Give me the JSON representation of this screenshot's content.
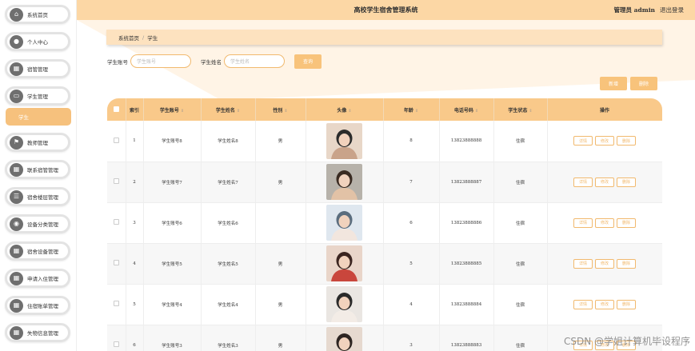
{
  "header": {
    "title": "高校学生宿舍管理系统",
    "user": "管理员 admin",
    "logout": "退出登录"
  },
  "sidebar": {
    "items": [
      {
        "label": "系统首页",
        "icon": "home-icon"
      },
      {
        "label": "个人中心",
        "icon": "user-icon"
      },
      {
        "label": "宿管管理",
        "icon": "grid-icon"
      },
      {
        "label": "学生管理",
        "icon": "chat-icon"
      },
      {
        "label": "教师管理",
        "icon": "flag-icon"
      },
      {
        "label": "联系宿管管理",
        "icon": "grid-icon"
      },
      {
        "label": "宿舍楼层管理",
        "icon": "list-icon"
      },
      {
        "label": "设备分类管理",
        "icon": "location-icon"
      },
      {
        "label": "宿舍设备管理",
        "icon": "grid-icon"
      },
      {
        "label": "申请入住管理",
        "icon": "grid-icon"
      },
      {
        "label": "住宿账单管理",
        "icon": "grid-icon"
      },
      {
        "label": "失物信息管理",
        "icon": "grid-icon"
      }
    ],
    "active_sub": "学生"
  },
  "breadcrumb": {
    "home": "系统首页",
    "separator": "/",
    "current": "学生"
  },
  "search": {
    "account_label": "学生账号",
    "account_placeholder": "学生账号",
    "name_label": "学生姓名",
    "name_placeholder": "学生姓名",
    "button": "查询"
  },
  "actions": {
    "add": "新增",
    "delete": "删除"
  },
  "table": {
    "headers": [
      "索引",
      "学生账号",
      "学生姓名",
      "性别",
      "头像",
      "年龄",
      "电话号码",
      "学生状态",
      "操作"
    ],
    "op_labels": {
      "detail": "详情",
      "edit": "修改",
      "delete": "删除"
    },
    "rows": [
      {
        "index": "1",
        "account": "学生账号8",
        "name": "学生姓名8",
        "gender": "男",
        "age": "8",
        "phone": "13823888888",
        "status": "住宿"
      },
      {
        "index": "2",
        "account": "学生账号7",
        "name": "学生姓名7",
        "gender": "男",
        "age": "7",
        "phone": "13823888887",
        "status": "住宿"
      },
      {
        "index": "3",
        "account": "学生账号6",
        "name": "学生姓名6",
        "gender": "",
        "age": "6",
        "phone": "13823888886",
        "status": "住宿"
      },
      {
        "index": "4",
        "account": "学生账号5",
        "name": "学生姓名5",
        "gender": "男",
        "age": "5",
        "phone": "13823888885",
        "status": "住宿"
      },
      {
        "index": "5",
        "account": "学生账号4",
        "name": "学生姓名4",
        "gender": "男",
        "age": "4",
        "phone": "13823888884",
        "status": "住宿"
      },
      {
        "index": "6",
        "account": "学生账号3",
        "name": "学生姓名3",
        "gender": "男",
        "age": "3",
        "phone": "13823888883",
        "status": "住宿"
      }
    ]
  },
  "watermark": "CSDN @学姐计算机毕设程序",
  "colors": {
    "accent": "#f8c37b",
    "header_bg": "#fcd7a5",
    "table_header": "#f9c98a",
    "breadcrumb_bg": "#fde2bf"
  }
}
